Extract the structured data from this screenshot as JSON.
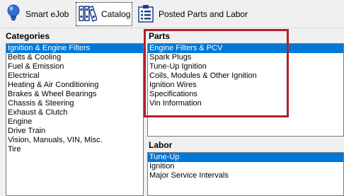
{
  "tabs": [
    {
      "label": "Smart eJob",
      "icon": "lightbulb-icon",
      "active": false
    },
    {
      "label": "Catalog",
      "icon": "books-icon",
      "active": true
    },
    {
      "label": "Posted Parts and Labor",
      "icon": "clipboard-icon",
      "active": false
    }
  ],
  "categories": {
    "title": "Categories",
    "items": [
      "Ignition & Engine Filters",
      "Belts & Cooling",
      "Fuel & Emission",
      "Electrical",
      "Heating & Air Conditioning",
      "Brakes & Wheel Bearings",
      "Chassis & Steering",
      "Exhaust & Clutch",
      "Engine",
      "Drive Train",
      "Vision, Manuals, VIN, Misc.",
      "Tire"
    ],
    "selected_index": 0
  },
  "parts": {
    "title": "Parts",
    "items": [
      "Engine Filters & PCV",
      "Spark Plugs",
      "Tune-Up Ignition",
      "Coils, Modules & Other Ignition",
      "Ignition Wires",
      "Specifications",
      "Vin Information"
    ],
    "selected_index": 0
  },
  "labor": {
    "title": "Labor",
    "items": [
      "Tune-Up",
      "Ignition",
      "Major Service Intervals"
    ],
    "selected_index": 0
  },
  "colors": {
    "selection": "#0078d7",
    "highlight_frame": "#b0202a",
    "background": "#f0f0f0"
  }
}
